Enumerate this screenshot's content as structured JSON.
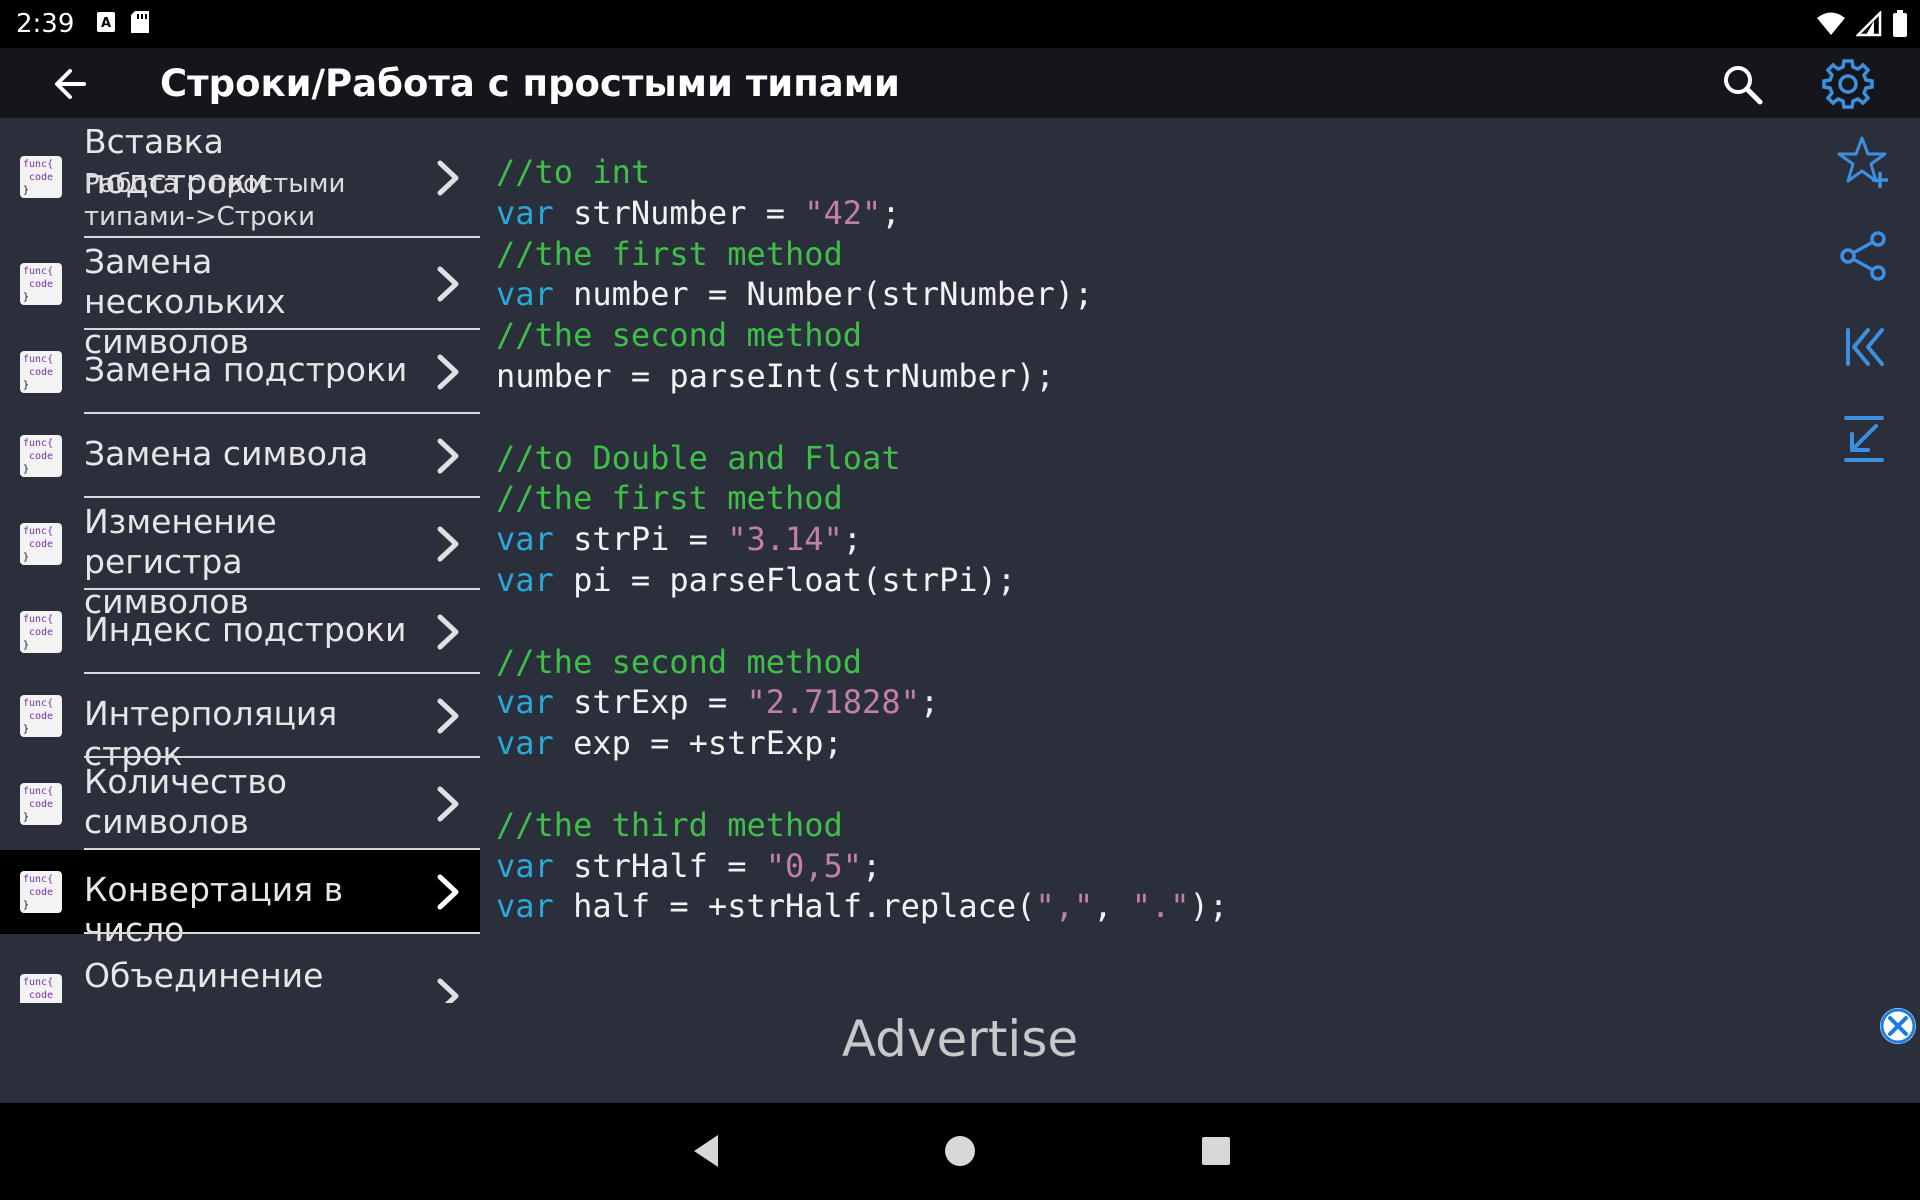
{
  "status": {
    "time": "2:39"
  },
  "appbar": {
    "title": "Строки/Работа с простыми типами"
  },
  "sidebar": {
    "items": [
      {
        "label": "Вставка подстроки",
        "sublabel": "Работа с простыми типами->Строки"
      },
      {
        "label": "Замена нескольких символов"
      },
      {
        "label": "Замена подстроки"
      },
      {
        "label": "Замена символа"
      },
      {
        "label": "Изменение регистра символов"
      },
      {
        "label": "Индекс подстроки"
      },
      {
        "label": "Интерполяция строк"
      },
      {
        "label": "Количество символов"
      },
      {
        "label": "Конвертация в число",
        "selected": true
      },
      {
        "label": "Объединение списка строк"
      }
    ],
    "icon_text": {
      "top": "func{",
      "middle": "code",
      "bottom": "}"
    }
  },
  "code": {
    "lines": [
      [
        {
          "t": "//to int",
          "c": "cm"
        }
      ],
      [
        {
          "t": "var",
          "c": "kw"
        },
        {
          "t": " strNumber = ",
          "c": "pl"
        },
        {
          "t": "\"42\"",
          "c": "st"
        },
        {
          "t": ";",
          "c": "pl"
        }
      ],
      [
        {
          "t": "//the first method",
          "c": "cm"
        }
      ],
      [
        {
          "t": "var",
          "c": "kw"
        },
        {
          "t": " number = Number(strNumber);",
          "c": "pl"
        }
      ],
      [
        {
          "t": "//the second method",
          "c": "cm"
        }
      ],
      [
        {
          "t": "number = parseInt(strNumber);",
          "c": "pl"
        }
      ],
      [],
      [
        {
          "t": "//to Double and Float",
          "c": "cm"
        }
      ],
      [
        {
          "t": "//the first method",
          "c": "cm"
        }
      ],
      [
        {
          "t": "var",
          "c": "kw"
        },
        {
          "t": " strPi = ",
          "c": "pl"
        },
        {
          "t": "\"3.14\"",
          "c": "st"
        },
        {
          "t": ";",
          "c": "pl"
        }
      ],
      [
        {
          "t": "var",
          "c": "kw"
        },
        {
          "t": " pi = parseFloat(strPi);",
          "c": "pl"
        }
      ],
      [],
      [
        {
          "t": "//the second method",
          "c": "cm"
        }
      ],
      [
        {
          "t": "var",
          "c": "kw"
        },
        {
          "t": " strExp = ",
          "c": "pl"
        },
        {
          "t": "\"2.71828\"",
          "c": "st"
        },
        {
          "t": ";",
          "c": "pl"
        }
      ],
      [
        {
          "t": "var",
          "c": "kw"
        },
        {
          "t": " exp = +strExp;",
          "c": "pl"
        }
      ],
      [],
      [
        {
          "t": "//the third method",
          "c": "cm"
        }
      ],
      [
        {
          "t": "var",
          "c": "kw"
        },
        {
          "t": " strHalf = ",
          "c": "pl"
        },
        {
          "t": "\"0,5\"",
          "c": "st"
        },
        {
          "t": ";",
          "c": "pl"
        }
      ],
      [
        {
          "t": "var",
          "c": "kw"
        },
        {
          "t": " half = +strHalf.replace(",
          "c": "pl"
        },
        {
          "t": "\",\"",
          "c": "st"
        },
        {
          "t": ", ",
          "c": "pl"
        },
        {
          "t": "\".\"",
          "c": "st"
        },
        {
          "t": ");",
          "c": "pl"
        }
      ]
    ]
  },
  "right_toolbar": [
    "star-add-icon",
    "share-icon",
    "first-icon",
    "download-icon"
  ],
  "advert": {
    "label": "Advertise"
  },
  "colors": {
    "background": "#2b2f3b",
    "appbar": "#14161c",
    "keyword": "#2aa8d8",
    "comment": "#3fbf48",
    "string": "#c27fa8",
    "accent": "#3d8fe0"
  }
}
